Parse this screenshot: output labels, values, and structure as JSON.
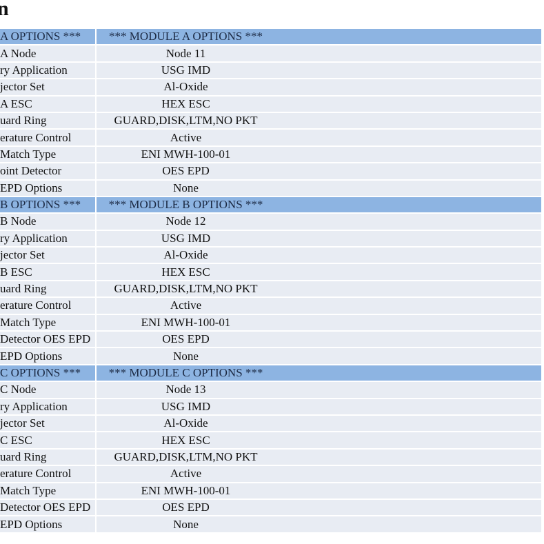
{
  "title": "n",
  "colors": {
    "header_bg": "#8db4e2",
    "row_bg": "#e8ecf3"
  },
  "rows": [
    {
      "header": true,
      "label": "A OPTIONS ***",
      "value": "*** MODULE A OPTIONS ***"
    },
    {
      "label": "A Node",
      "value": "Node 11"
    },
    {
      "label": "ry Application",
      "value": "USG IMD"
    },
    {
      "label": "jector Set",
      "value": "Al-Oxide"
    },
    {
      "label": "A ESC",
      "value": "HEX ESC"
    },
    {
      "label": "uard Ring",
      "value": "GUARD,DISK,LTM,NO PKT"
    },
    {
      "label": "erature Control",
      "value": "Active"
    },
    {
      "label": " Match Type",
      "value": "ENI MWH-100-01"
    },
    {
      "label": "oint Detector",
      "value": "OES EPD"
    },
    {
      "label": "EPD Options",
      "value": "None"
    },
    {
      "header": true,
      "label": "B OPTIONS ***",
      "value": "*** MODULE B OPTIONS ***"
    },
    {
      "label": "B Node",
      "value": "Node 12"
    },
    {
      "label": "ry Application",
      "value": "USG IMD"
    },
    {
      "label": "jector Set",
      "value": "Al-Oxide"
    },
    {
      "label": "B ESC",
      "value": "HEX ESC"
    },
    {
      "label": "uard Ring",
      "value": "GUARD,DISK,LTM,NO PKT"
    },
    {
      "label": "erature Control",
      "value": "Active"
    },
    {
      "label": " Match Type",
      "value": "ENI MWH-100-01"
    },
    {
      "label": "Detector OES EPD",
      "value": "OES EPD"
    },
    {
      "label": "EPD Options",
      "value": "None"
    },
    {
      "header": true,
      "label": "C OPTIONS ***",
      "value": "*** MODULE C OPTIONS ***"
    },
    {
      "label": "C Node",
      "value": "Node 13"
    },
    {
      "label": "ry Application",
      "value": "USG IMD"
    },
    {
      "label": "jector Set",
      "value": "Al-Oxide"
    },
    {
      "label": "C ESC",
      "value": "HEX ESC"
    },
    {
      "label": "uard Ring",
      "value": "GUARD,DISK,LTM,NO PKT"
    },
    {
      "label": "erature Control",
      "value": "Active"
    },
    {
      "label": " Match Type",
      "value": "ENI MWH-100-01"
    },
    {
      "label": "Detector OES EPD",
      "value": "OES EPD"
    },
    {
      "label": "EPD Options",
      "value": "None"
    }
  ]
}
